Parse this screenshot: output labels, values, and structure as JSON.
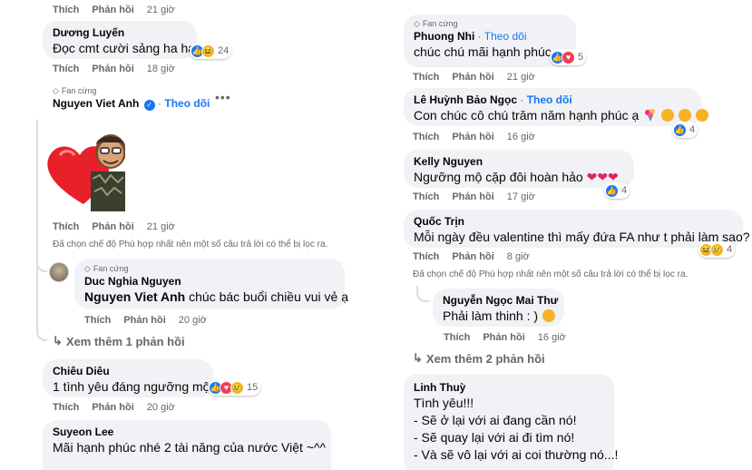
{
  "left": {
    "top_actions": {
      "like": "Thích",
      "reply": "Phản hồi",
      "time": "21 giờ"
    },
    "c1": {
      "author": "Dương Luyến",
      "text": "Đọc cmt cười sảng ha ha",
      "count": "24",
      "like": "Thích",
      "reply": "Phản hồi",
      "time": "18 giờ"
    },
    "c2": {
      "badge": "Fan cứng",
      "author": "Nguyen Viet Anh",
      "follow": "Theo dõi",
      "like": "Thích",
      "reply": "Phản hồi",
      "time": "21 giờ"
    },
    "filter_note": "Đã chọn chế độ Phù hợp nhất nên một số câu trả lời có thể bị lọc ra.",
    "reply1": {
      "badge": "Fan cứng",
      "author": "Duc Nghia Nguyen",
      "mention": "Nguyen Viet Anh",
      "text": " chúc bác buổi chiều vui vẻ ạ",
      "like": "Thích",
      "reply": "Phản hồi",
      "time": "20 giờ"
    },
    "more1": "Xem thêm 1 phản hồi",
    "c3": {
      "author": "Chiêu Diêu",
      "text": "1 tình yêu đáng ngưỡng mộ",
      "count": "15",
      "like": "Thích",
      "reply": "Phản hồi",
      "time": "20 giờ"
    },
    "c4": {
      "author": "Suyeon Lee",
      "text": "Mãi hạnh phúc nhé 2 tài năng của nước Việt ~^^"
    }
  },
  "right": {
    "c1": {
      "badge": "Fan cứng",
      "author": "Phuong Nhi",
      "follow": "Theo dõi",
      "text": "chúc chú mãi hạnh phúc",
      "count": "5",
      "like": "Thích",
      "reply": "Phản hồi",
      "time": "21 giờ"
    },
    "c2": {
      "author": "Lê Huỳnh Bảo Ngọc",
      "follow": "Theo dõi",
      "text": "Con chúc cô chú trăm năm hạnh phúc ạ",
      "count": "4",
      "like": "Thích",
      "reply": "Phản hồi",
      "time": "16 giờ"
    },
    "c3": {
      "author": "Kelly Nguyen",
      "text": "Ngưỡng mộ cặp đôi hoàn hảo",
      "count": "4",
      "like": "Thích",
      "reply": "Phản hồi",
      "time": "17 giờ"
    },
    "c4": {
      "author": "Quốc Trịn",
      "text": "Mỗi ngày đều valentine thì mấy đứa FA như t phải làm sao?",
      "count": "4",
      "like": "Thích",
      "reply": "Phản hồi",
      "time": "8 giờ"
    },
    "filter_note": "Đã chọn chế độ Phù hợp nhất nên một số câu trả lời có thể bị lọc ra.",
    "reply1": {
      "author": "Nguyễn Ngọc Mai Thư",
      "text": "Phải làm thinh : )",
      "like": "Thích",
      "reply": "Phản hồi",
      "time": "16 giờ"
    },
    "more1": "Xem thêm 2 phản hồi",
    "c5": {
      "author": "Linh Thuỳ",
      "line1": "Tình yêu!!!",
      "line2": "- Sẽ ở lại với ai đang cần nó!",
      "line3": "- Sẽ quay lại với ai đi tìm nó!",
      "line4": "- Và sẽ vô lại với ai coi thường nó...!"
    }
  }
}
